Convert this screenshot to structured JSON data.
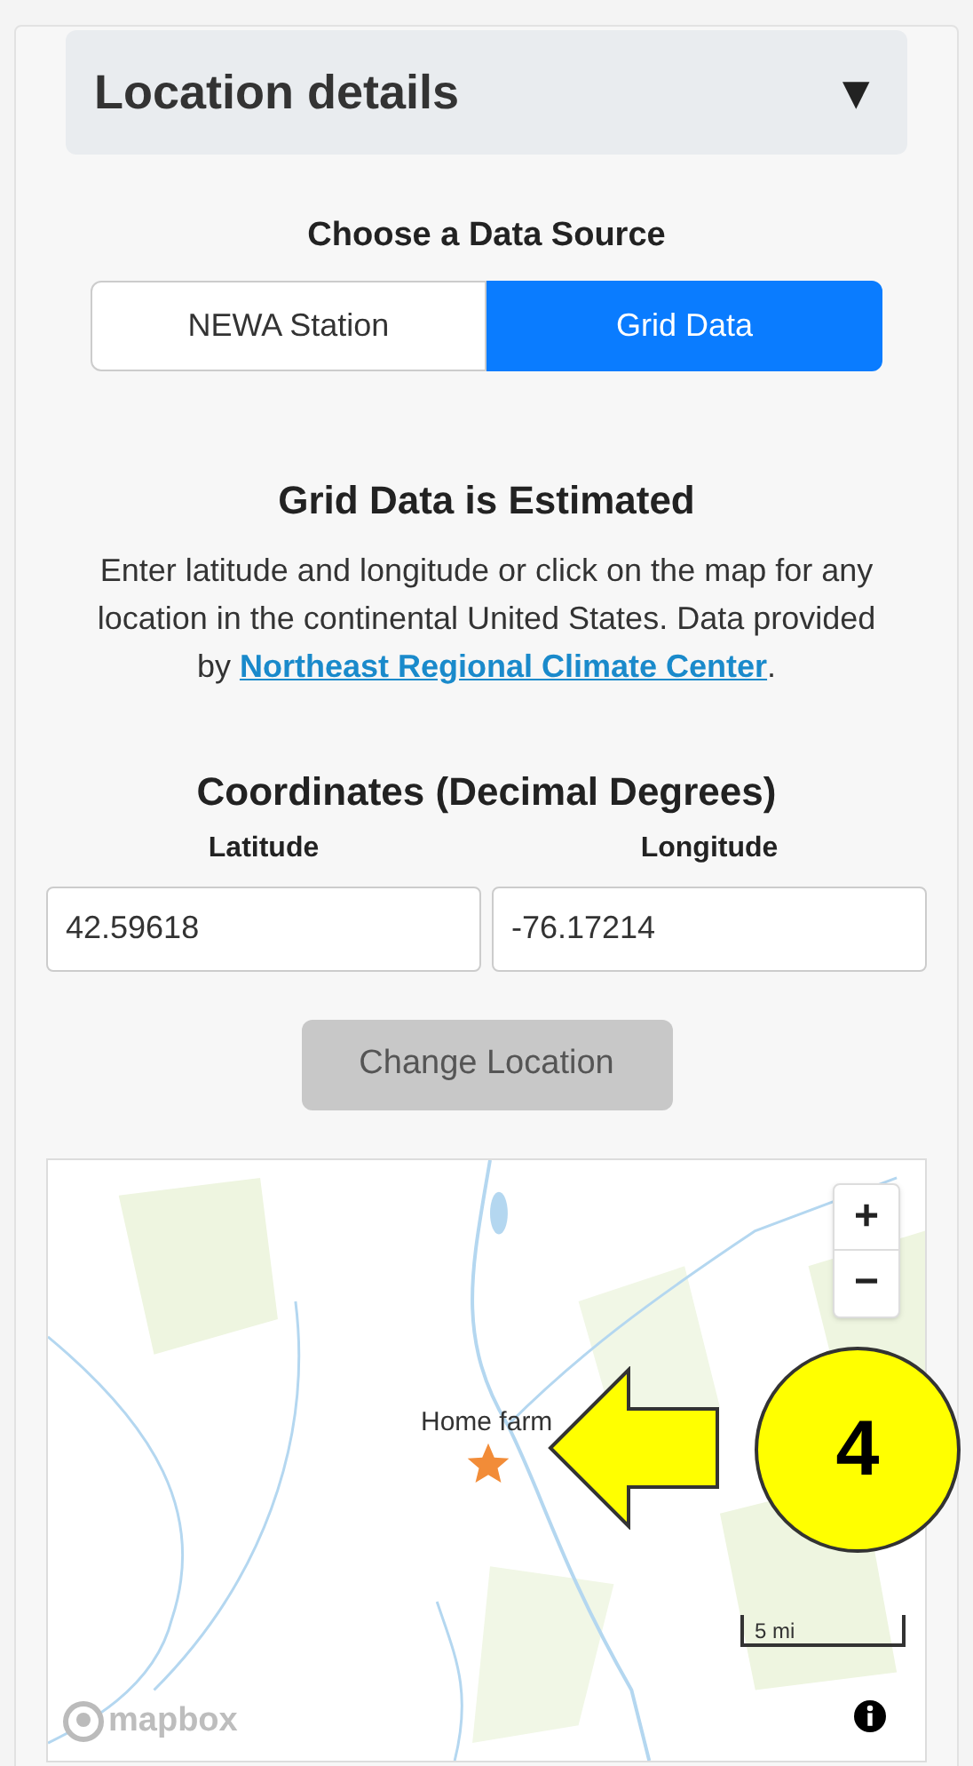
{
  "header": {
    "title": "Location details",
    "toggle_icon": "▼",
    "expanded": true
  },
  "data_source": {
    "heading": "Choose a Data Source",
    "options": [
      {
        "label": "NEWA Station",
        "selected": false
      },
      {
        "label": "Grid Data",
        "selected": true
      }
    ]
  },
  "notice": {
    "heading": "Grid Data is Estimated",
    "text": "Enter latitude and longitude or click on the map for any location in the continental United States. Data provided by ",
    "link": "Northeast Regional Climate Center",
    "after": "."
  },
  "coordinates": {
    "heading": "Coordinates (Decimal Degrees)",
    "fields": [
      {
        "label": "Latitude",
        "value": "42.59618"
      },
      {
        "label": "Longitude",
        "value": "-76.17214"
      }
    ]
  },
  "change_button": {
    "label": "Change Location",
    "disabled": true
  },
  "map": {
    "kind": "picture",
    "zoom_in": "+",
    "zoom_out": "−",
    "marker_label": "Home farm",
    "scale": "5 mi",
    "logo": "mapbox"
  },
  "callout": {
    "number": "4"
  }
}
